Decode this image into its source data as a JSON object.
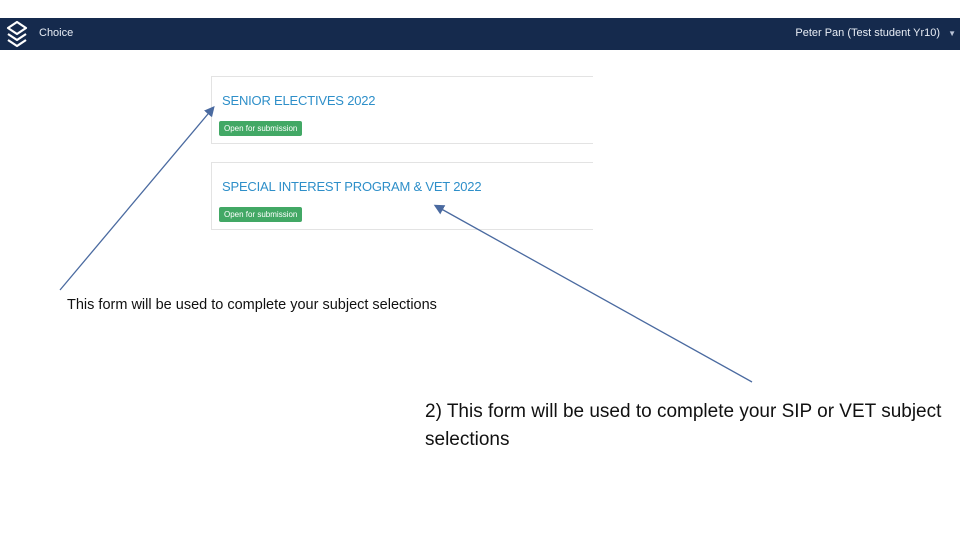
{
  "header": {
    "app_name": "Choice",
    "user_name": "Peter Pan (Test student Yr10)",
    "background_color": "#152a4d"
  },
  "cards": [
    {
      "title": "SENIOR ELECTIVES 2022",
      "status": "Open for submission"
    },
    {
      "title": "SPECIAL INTEREST PROGRAM & VET 2022",
      "status": "Open for submission"
    }
  ],
  "annotations": {
    "note1": "This form will be used to complete your subject selections",
    "note2": "2) This form will be used to complete your SIP or VET subject selections"
  },
  "colors": {
    "title_blue": "#2e8fc9",
    "badge_green": "#42a865",
    "arrow": "#4a6aa0"
  }
}
